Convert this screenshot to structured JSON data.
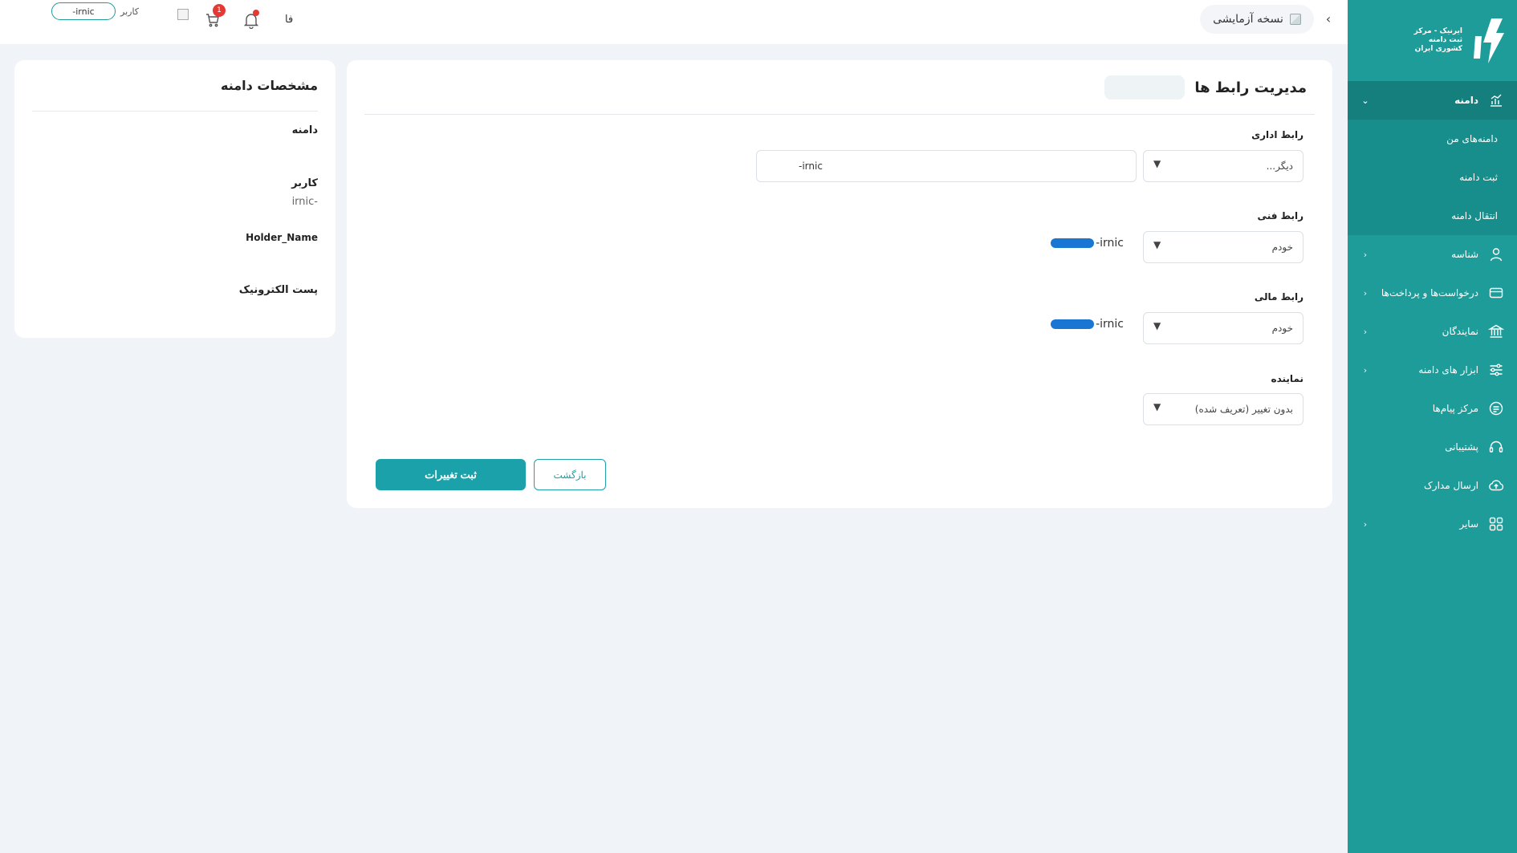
{
  "sidebar": {
    "logo_text": "ایرنیک - مرکز ثبت دامنه کشوری ایران",
    "domain_group": "دامنه",
    "domain_subitems": [
      "دامنه‌های من",
      "ثبت دامنه",
      "انتقال دامنه"
    ],
    "items": [
      {
        "label": "شناسه",
        "icon": "user-icon"
      },
      {
        "label": "درخواست‌ها و پرداخت‌ها",
        "icon": "card-icon"
      },
      {
        "label": "نمایندگان",
        "icon": "bank-icon"
      },
      {
        "label": "ابزار های دامنه",
        "icon": "sliders-icon"
      },
      {
        "label": "مرکز پیام‌ها",
        "icon": "message-icon"
      },
      {
        "label": "پشتیبانی",
        "icon": "headset-icon"
      },
      {
        "label": "ارسال مدارک",
        "icon": "upload-icon"
      },
      {
        "label": "سایر",
        "icon": "grid-icon"
      }
    ],
    "colors": {
      "bg": "#1e9c9a",
      "active": "#157f7d"
    }
  },
  "topbar": {
    "env_label": "نسخه آزمایشی",
    "lang": "فا",
    "cart_count": "1",
    "user_label": "کاربر",
    "user_handle": "-irnic"
  },
  "main": {
    "title": "مدیریت رابط ها",
    "admin_label": "رابط اداری",
    "admin_select": "دیگر...",
    "admin_input": "-irnic",
    "tech_label": "رابط فنی",
    "tech_select": "خودم",
    "tech_value": "-irnic",
    "finance_label": "رابط مالی",
    "finance_select": "خودم",
    "finance_value": "-irnic",
    "agent_label": "نماینده",
    "agent_select": "بدون تغییر (تعریف شده)",
    "submit_label": "ثبت تغییرات",
    "back_label": "بازگشت",
    "colors": {
      "primary": "#1aa1a9"
    }
  },
  "details": {
    "title": "مشخصات دامنه",
    "domain_label": "دامنه",
    "user_label": "کاربر",
    "user_value": "-irnic",
    "holder_label": "Holder_Name",
    "email_label": "پست الکترونیک"
  }
}
